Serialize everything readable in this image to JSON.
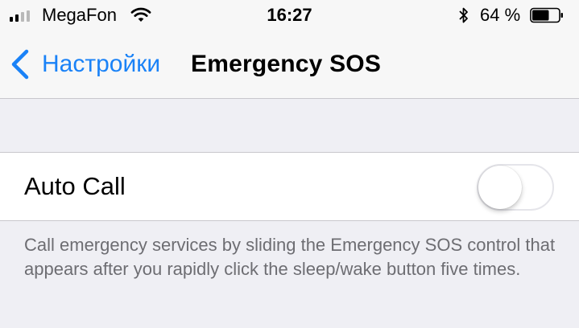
{
  "status_bar": {
    "carrier": "MegaFon",
    "time": "16:27",
    "battery_percent": "64 %",
    "signal_bars_filled": 2,
    "signal_bars_total": 4,
    "battery_level": 0.64,
    "icons": [
      "signal-icon",
      "wifi-icon",
      "bluetooth-icon",
      "battery-icon"
    ]
  },
  "nav": {
    "back_label": "Настройки",
    "title": "Emergency SOS",
    "accent_color": "#1a82f7"
  },
  "auto_call": {
    "label": "Auto Call",
    "enabled": false
  },
  "footer": {
    "text": "Call emergency services by sliding the Emergency SOS control that appears after you rapidly click the sleep/wake button five times."
  }
}
